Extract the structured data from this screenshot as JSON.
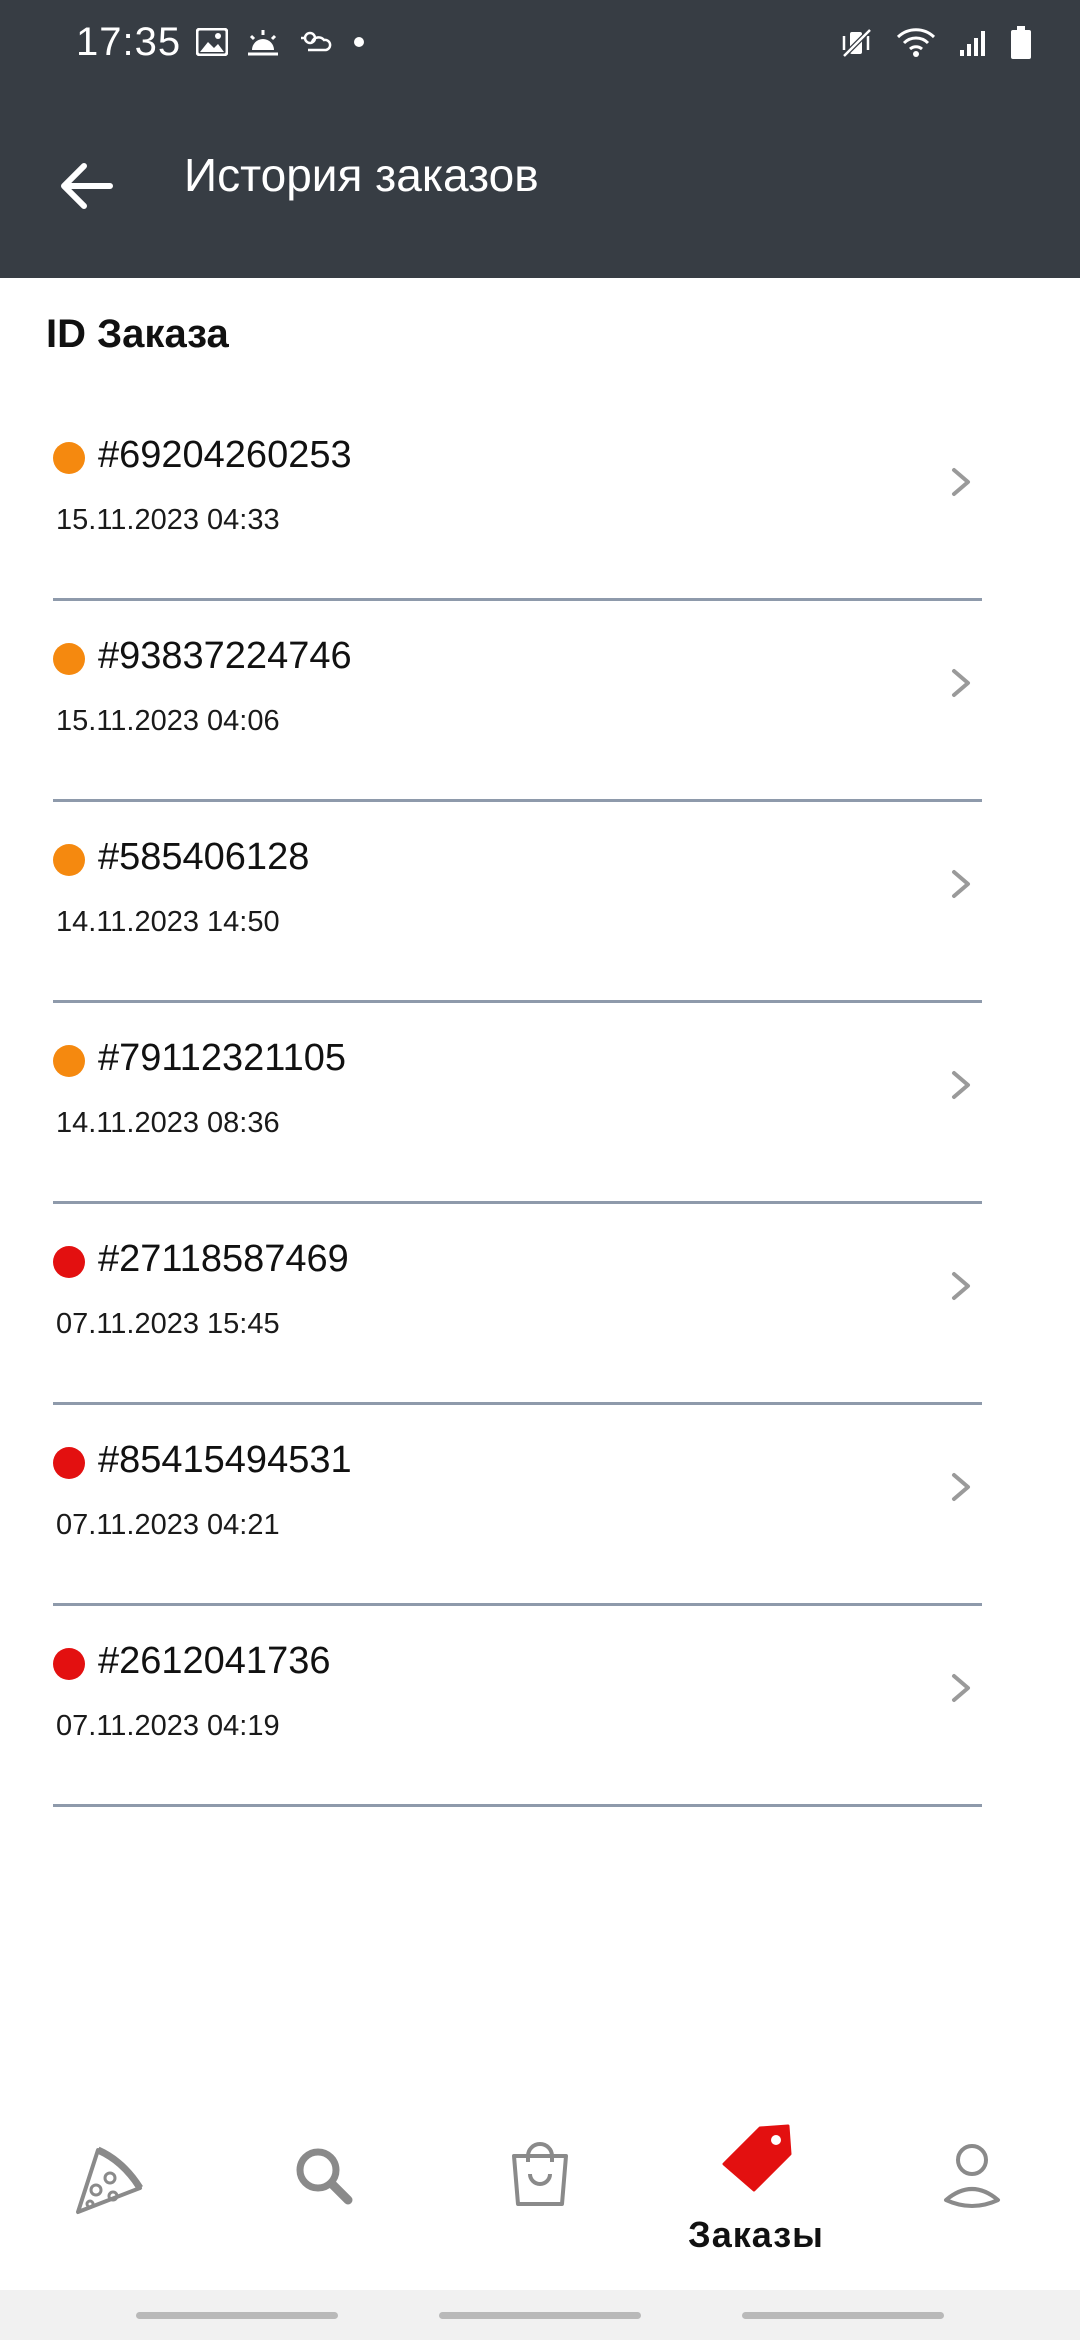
{
  "status_bar": {
    "time": "17:35",
    "left_icons": [
      "image-icon",
      "sunrise-icon",
      "weather-icon",
      "dot-icon"
    ],
    "right_icons": [
      "vibrate-icon",
      "wifi-icon",
      "signal-icon",
      "battery-icon"
    ]
  },
  "app_bar": {
    "back_icon": "arrow-left-icon",
    "title": "История заказов"
  },
  "section": {
    "title": "ID Заказа"
  },
  "colors": {
    "app_bar_bg": "#373d44",
    "status_pending": "#f5890f",
    "status_cancelled": "#e31010",
    "accent": "#e31010",
    "divider": "#8e9aab"
  },
  "orders": [
    {
      "id": "#69204260253",
      "date": "15.11.2023 04:33",
      "status_color": "#f5890f"
    },
    {
      "id": "#93837224746",
      "date": "15.11.2023 04:06",
      "status_color": "#f5890f"
    },
    {
      "id": "#585406128",
      "date": "14.11.2023 14:50",
      "status_color": "#f5890f"
    },
    {
      "id": "#79112321105",
      "date": "14.11.2023 08:36",
      "status_color": "#f5890f"
    },
    {
      "id": "#27118587469",
      "date": "07.11.2023 15:45",
      "status_color": "#e31010"
    },
    {
      "id": "#85415494531",
      "date": "07.11.2023 04:21",
      "status_color": "#e31010"
    },
    {
      "id": "#2612041736",
      "date": "07.11.2023 04:19",
      "status_color": "#e31010"
    }
  ],
  "bottom_nav": {
    "items": [
      {
        "icon": "pizza-icon",
        "label": ""
      },
      {
        "icon": "search-icon",
        "label": ""
      },
      {
        "icon": "shopping-bag-icon",
        "label": ""
      },
      {
        "icon": "tag-icon",
        "label": "Заказы",
        "active": true
      },
      {
        "icon": "user-icon",
        "label": ""
      }
    ]
  }
}
